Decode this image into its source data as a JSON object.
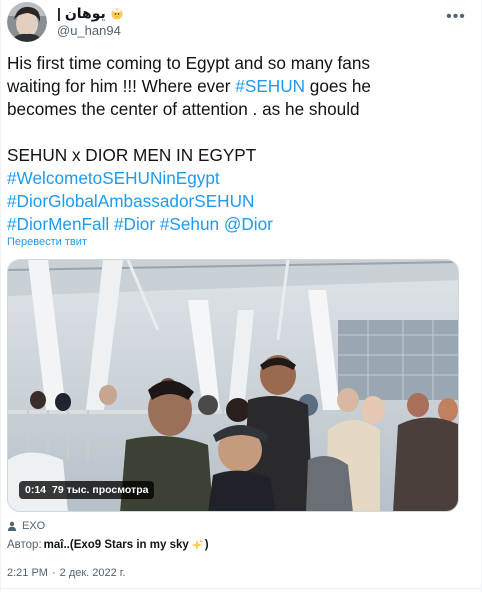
{
  "user": {
    "display_name": "| يوهان",
    "handle": "@u_han94",
    "name_emoji": "chick-emoji"
  },
  "menu": {
    "more_icon": "more-dots-icon",
    "more_label": "•••"
  },
  "tweet": {
    "lines": [
      [
        {
          "t": "His first time coming to Egypt and so many fans",
          "link": false
        }
      ],
      [
        {
          "t": "waiting for him  !!! Where ever ",
          "link": false
        },
        {
          "t": "#SEHUN",
          "link": true
        },
        {
          "t": " goes he",
          "link": false
        }
      ],
      [
        {
          "t": "becomes the center of attention . as he should",
          "link": false
        }
      ],
      [],
      [
        {
          "t": "SEHUN x DIOR MEN IN EGYPT",
          "link": false
        }
      ],
      [
        {
          "t": "#WelcometoSEHUNinEgypt",
          "link": true
        }
      ],
      [
        {
          "t": "#DiorGlobalAmbassadorSEHUN",
          "link": true
        }
      ],
      [
        {
          "t": "#DiorMenFall",
          "link": true
        },
        {
          "t": " ",
          "link": false
        },
        {
          "t": "#Dior",
          "link": true
        },
        {
          "t": " ",
          "link": false
        },
        {
          "t": "#Sehun",
          "link": true
        },
        {
          "t": " ",
          "link": false
        },
        {
          "t": "@Dior",
          "link": true
        }
      ]
    ],
    "translate_label": "Перевести твит"
  },
  "video": {
    "duration": "0:14",
    "views": "79 тыс. просмотра"
  },
  "credit": {
    "icon": "person-icon",
    "label": "EXO"
  },
  "author": {
    "prefix": "Автор: ",
    "name": "maî..(Exo9 Stars in my sky",
    "suffix": ")",
    "emoji": "sparkles-emoji"
  },
  "timestamp": {
    "time": "2:21 PM",
    "separator": "·",
    "date": "2 дек. 2022 г."
  },
  "colors": {
    "link": "#1d9bf0",
    "text": "#0f1419",
    "secondary": "#536471"
  }
}
